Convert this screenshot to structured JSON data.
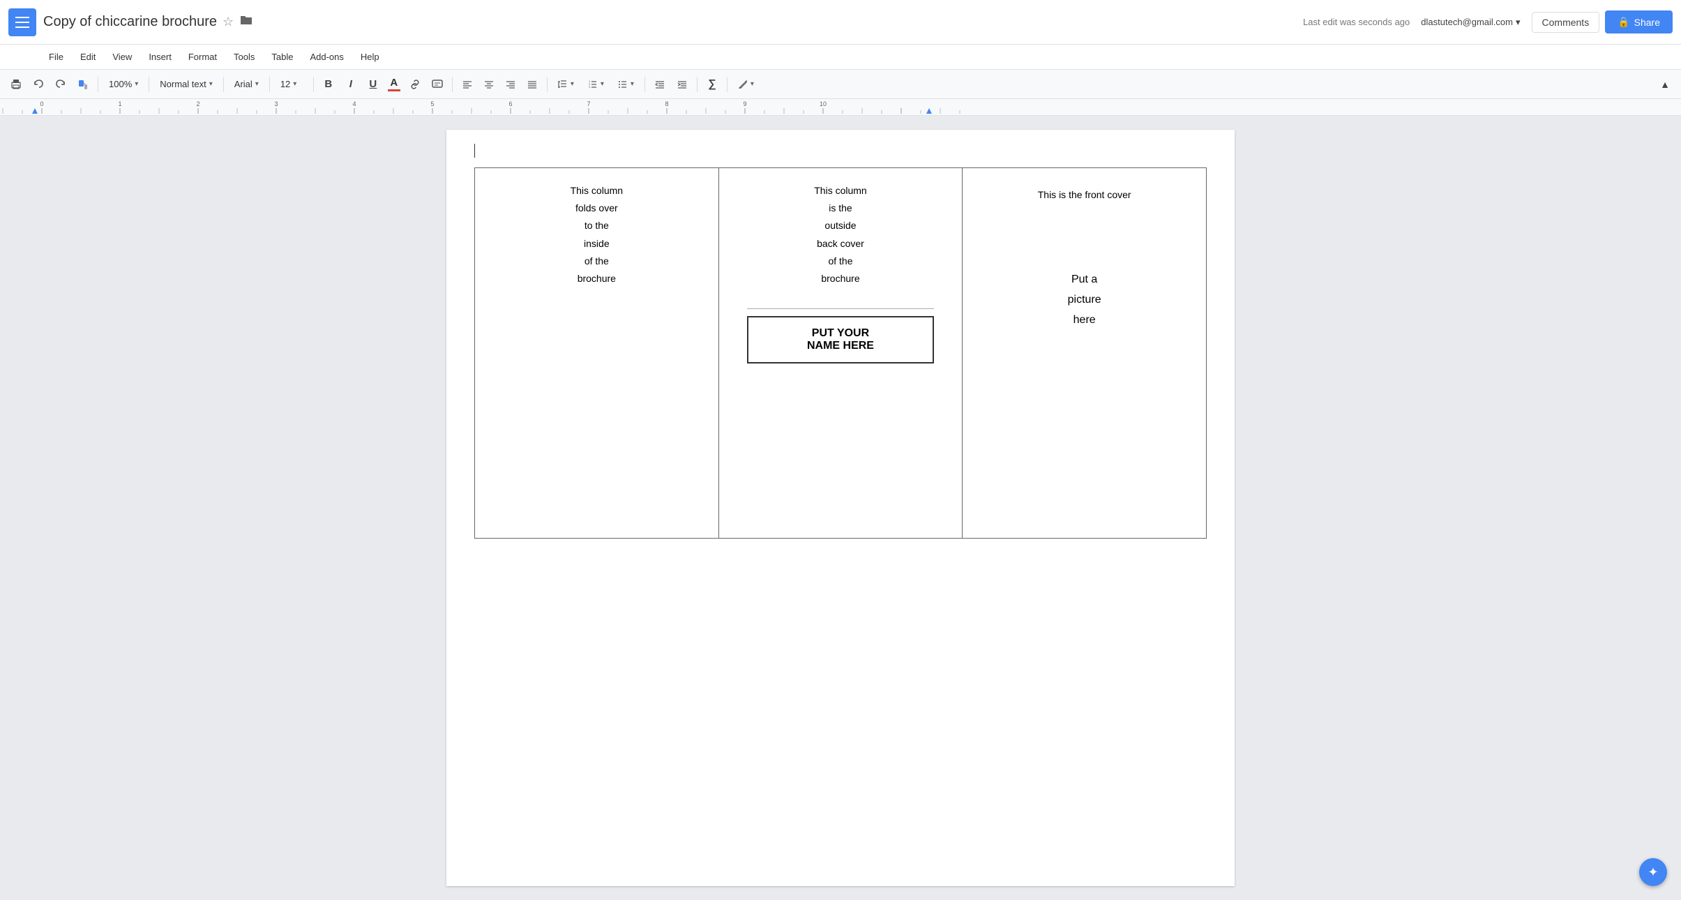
{
  "app": {
    "menu_icon": "☰",
    "title": "Copy of chiccarine brochure",
    "star_icon": "☆",
    "folder_icon": "▪"
  },
  "header": {
    "user_email": "dlastutech@gmail.com",
    "email_arrow": "▾",
    "edit_status": "Last edit was seconds ago",
    "comments_label": "Comments",
    "share_label": "Share",
    "share_lock_icon": "🔒"
  },
  "menu": {
    "items": [
      "File",
      "Edit",
      "View",
      "Insert",
      "Format",
      "Tools",
      "Table",
      "Add-ons",
      "Help"
    ]
  },
  "toolbar": {
    "print_icon": "🖨",
    "undo_icon": "↩",
    "redo_icon": "↪",
    "paint_icon": "🖌",
    "zoom_value": "100%",
    "zoom_arrow": "▾",
    "style_value": "Normal text",
    "style_arrow": "▾",
    "font_value": "Arial",
    "font_arrow": "▾",
    "fontsize_value": "12",
    "fontsize_arrow": "▾",
    "bold": "B",
    "italic": "I",
    "underline": "U",
    "text_color_label": "A",
    "link_icon": "🔗",
    "comment_icon": "💬",
    "align_left": "≡",
    "align_center": "≡",
    "align_right": "≡",
    "align_justify": "≡",
    "line_spacing_icon": "↕",
    "line_spacing_arrow": "▾",
    "numbered_list_icon": "≡",
    "numbered_list_arrow": "▾",
    "bullet_list_icon": "≡",
    "bullet_list_arrow": "▾",
    "indent_decrease_icon": "◀",
    "indent_increase_icon": "▶",
    "formula_icon": "∑",
    "pen_icon": "✏",
    "pen_arrow": "▾",
    "collapse_icon": "▲"
  },
  "document": {
    "col1": {
      "text": "This column\nfolds over\nto the\ninside\nof the\nbrochure"
    },
    "col2": {
      "top_text": "This column\nis the\noutside\nback cover\nof the\nbrochure",
      "name_box_text": "PUT YOUR\nNAME HERE"
    },
    "col3": {
      "front_cover_text": "This is the front cover",
      "picture_text": "Put a\npicture\nhere"
    }
  }
}
